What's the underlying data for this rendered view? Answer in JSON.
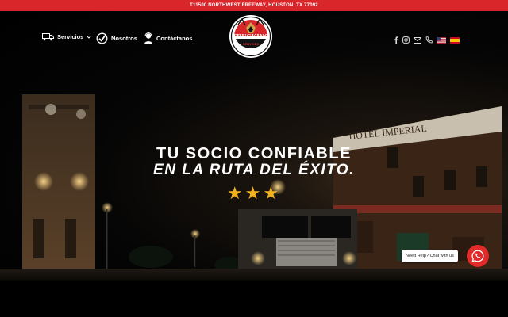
{
  "topbar": {
    "address": "T11500 NORTHWEST FREEWAY, HOUSTON, TX 77092"
  },
  "nav": {
    "items": [
      {
        "label": "Servicios",
        "icon": "truck-icon",
        "has_dropdown": true
      },
      {
        "label": "Nosotros",
        "icon": "check-badge-icon"
      },
      {
        "label": "Contáctanos",
        "icon": "support-agent-icon"
      }
    ],
    "logo": {
      "text": "TRUCKING",
      "subtext": "SERVICES"
    }
  },
  "social": [
    "facebook-icon",
    "instagram-icon",
    "email-icon",
    "phone-icon",
    "us-flag-icon",
    "spain-flag-icon"
  ],
  "hero": {
    "line1": "TU SOCIO CONFIABLE",
    "line2": "EN LA RUTA DEL ÉXITO.",
    "stars": "★★★",
    "sign_text": "HOTEL IMPERIAL"
  },
  "chat": {
    "label": "Need Help? Chat with us"
  },
  "colors": {
    "accent": "#d8262b",
    "star": "#f2b21e",
    "chat": "#e22a2a"
  }
}
